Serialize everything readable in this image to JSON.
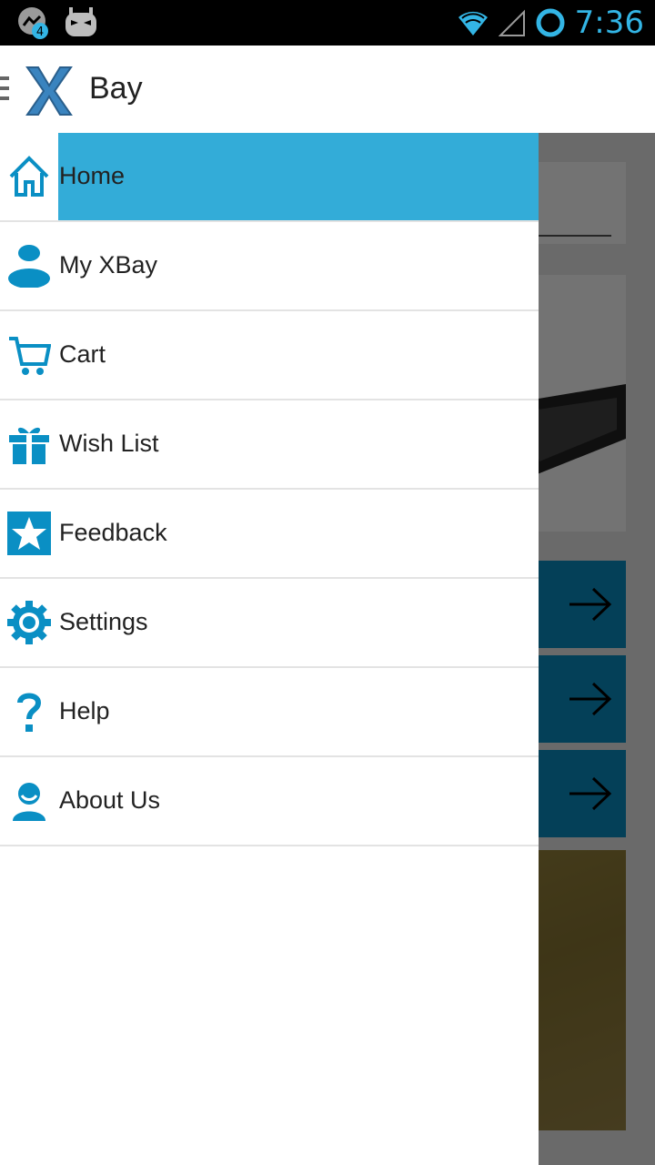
{
  "status_bar": {
    "notification_badge": "4",
    "time": "7:36",
    "icons": [
      "messenger-icon",
      "cyanogen-mascot-icon",
      "wifi-icon",
      "signal-icon",
      "sync-circle-icon"
    ]
  },
  "action_bar": {
    "title": "Bay",
    "logo_letter": "X",
    "menu_icon": "hamburger-icon"
  },
  "drawer": {
    "items": [
      {
        "label": "Home",
        "icon": "home-icon",
        "selected": true
      },
      {
        "label": "My XBay",
        "icon": "user-icon",
        "selected": false
      },
      {
        "label": "Cart",
        "icon": "cart-icon",
        "selected": false
      },
      {
        "label": "Wish List",
        "icon": "gift-icon",
        "selected": false
      },
      {
        "label": "Feedback",
        "icon": "star-icon",
        "selected": false
      },
      {
        "label": "Settings",
        "icon": "gear-icon",
        "selected": false
      },
      {
        "label": "Help",
        "icon": "question-icon",
        "selected": false
      },
      {
        "label": "About Us",
        "icon": "person-icon",
        "selected": false
      }
    ]
  },
  "colors": {
    "accent": "#33b5e5",
    "selected_bg": "#33acd8",
    "icon_blue": "#0a8fc4"
  }
}
